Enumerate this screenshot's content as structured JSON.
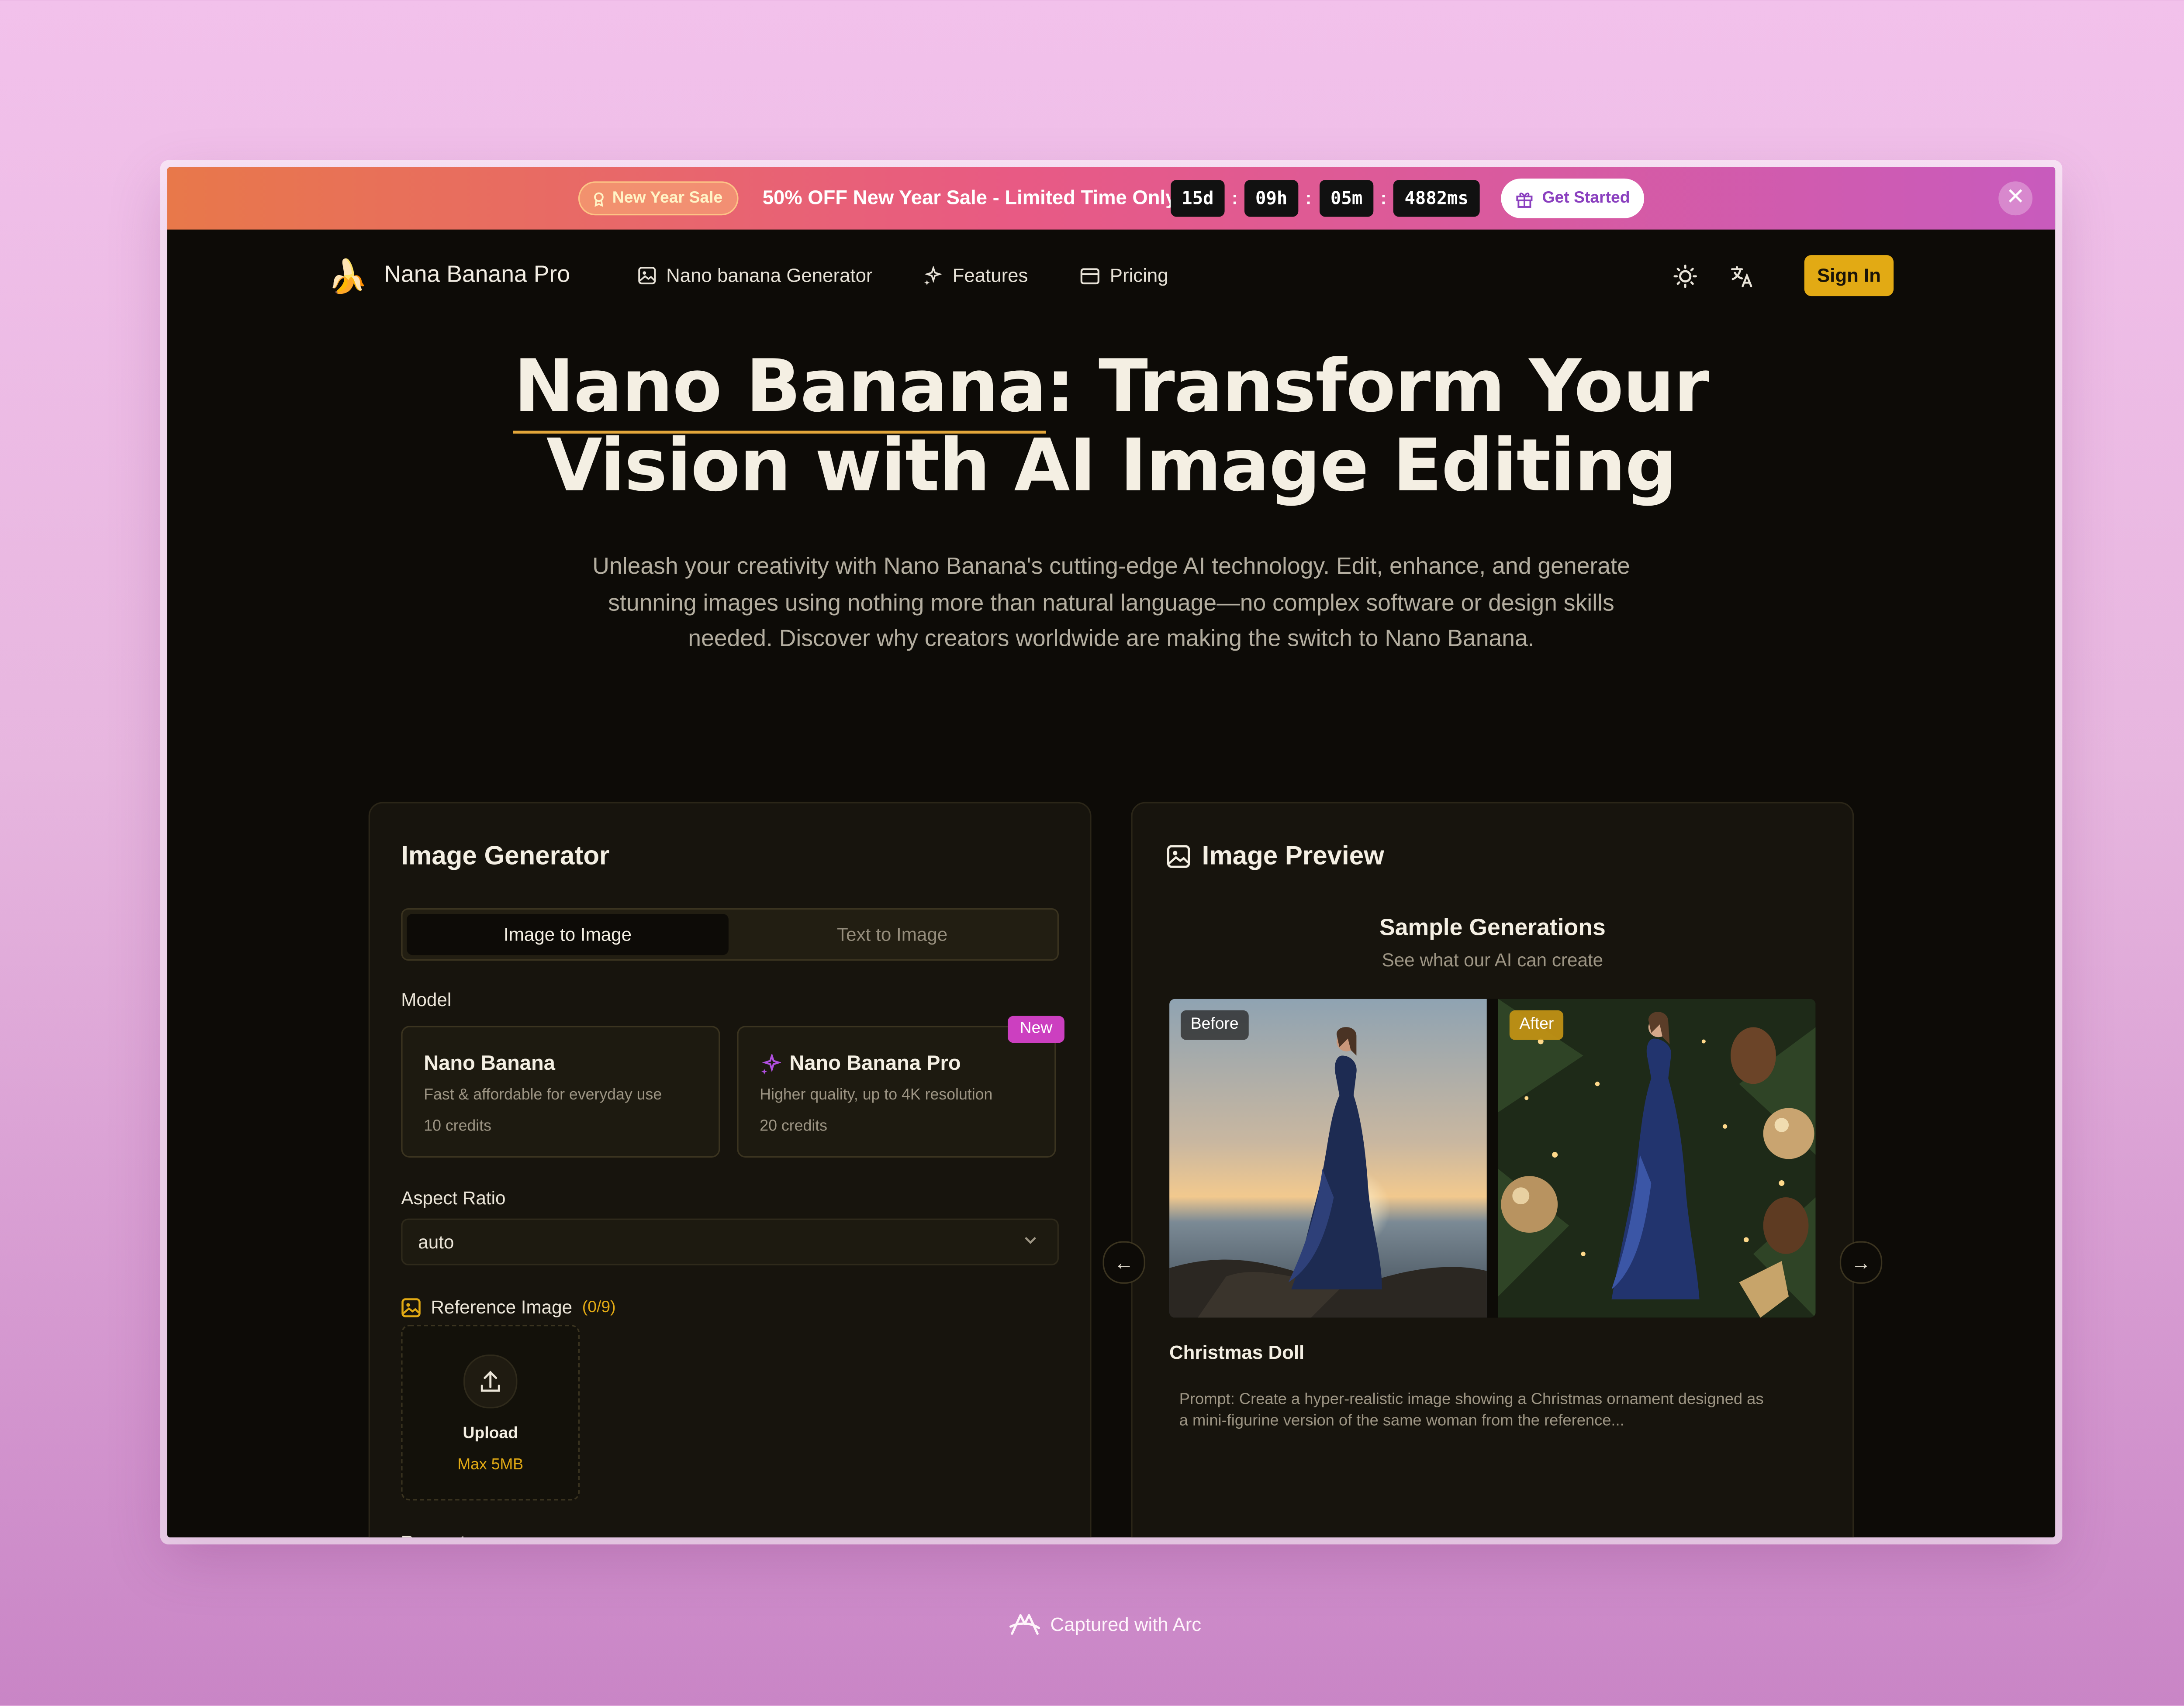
{
  "banner": {
    "sale_badge": "New Year Sale",
    "sale_text": "50% OFF New Year Sale - Limited Time Only!",
    "countdown": {
      "days": "15d",
      "hours": "09h",
      "minutes": "05m",
      "ms": "4882ms",
      "separator": ":"
    },
    "cta_label": "Get Started"
  },
  "nav": {
    "brand": "Nana Banana Pro",
    "links": [
      {
        "label": "Nano banana Generator",
        "icon": "image-icon"
      },
      {
        "label": "Features",
        "icon": "sparkles-icon"
      },
      {
        "label": "Pricing",
        "icon": "credit-card-icon"
      }
    ],
    "signin_label": "Sign In"
  },
  "hero": {
    "title_highlight": "Nano Banana",
    "title_rest1": ": Transform Your",
    "title_line2": "Vision with AI Image Editing",
    "subtitle": "Unleash your creativity with Nano Banana's cutting-edge AI technology. Edit, enhance, and generate stunning images using nothing more than natural language—no complex software or design skills needed. Discover why creators worldwide are making the switch to Nano Banana."
  },
  "generator": {
    "title": "Image Generator",
    "tabs": [
      "Image to Image",
      "Text to Image"
    ],
    "model_label": "Model",
    "models": [
      {
        "name": "Nano Banana",
        "desc": "Fast & affordable for everyday use",
        "credits": "10 credits"
      },
      {
        "name": "Nano Banana Pro",
        "desc": "Higher quality, up to 4K resolution",
        "credits": "20 credits",
        "badge": "New"
      }
    ],
    "aspect_label": "Aspect Ratio",
    "aspect_value": "auto",
    "reference_label": "Reference Image",
    "reference_count": "(0/9)",
    "upload_label": "Upload",
    "upload_max": "Max 5MB",
    "prompt_label": "Prompt"
  },
  "preview": {
    "title": "Image Preview",
    "sample_title": "Sample Generations",
    "sample_subtitle": "See what our AI can create",
    "before_tag": "Before",
    "after_tag": "After",
    "sample_name": "Christmas Doll",
    "sample_prompt": "Prompt: Create a hyper-realistic image showing a Christmas ornament designed as a mini-figurine version of the same woman from the reference..."
  },
  "caption": "Captured with Arc",
  "colors": {
    "accent": "#e2aa14",
    "badge_new": "#cc3fc0",
    "background": "#0d0b07"
  }
}
